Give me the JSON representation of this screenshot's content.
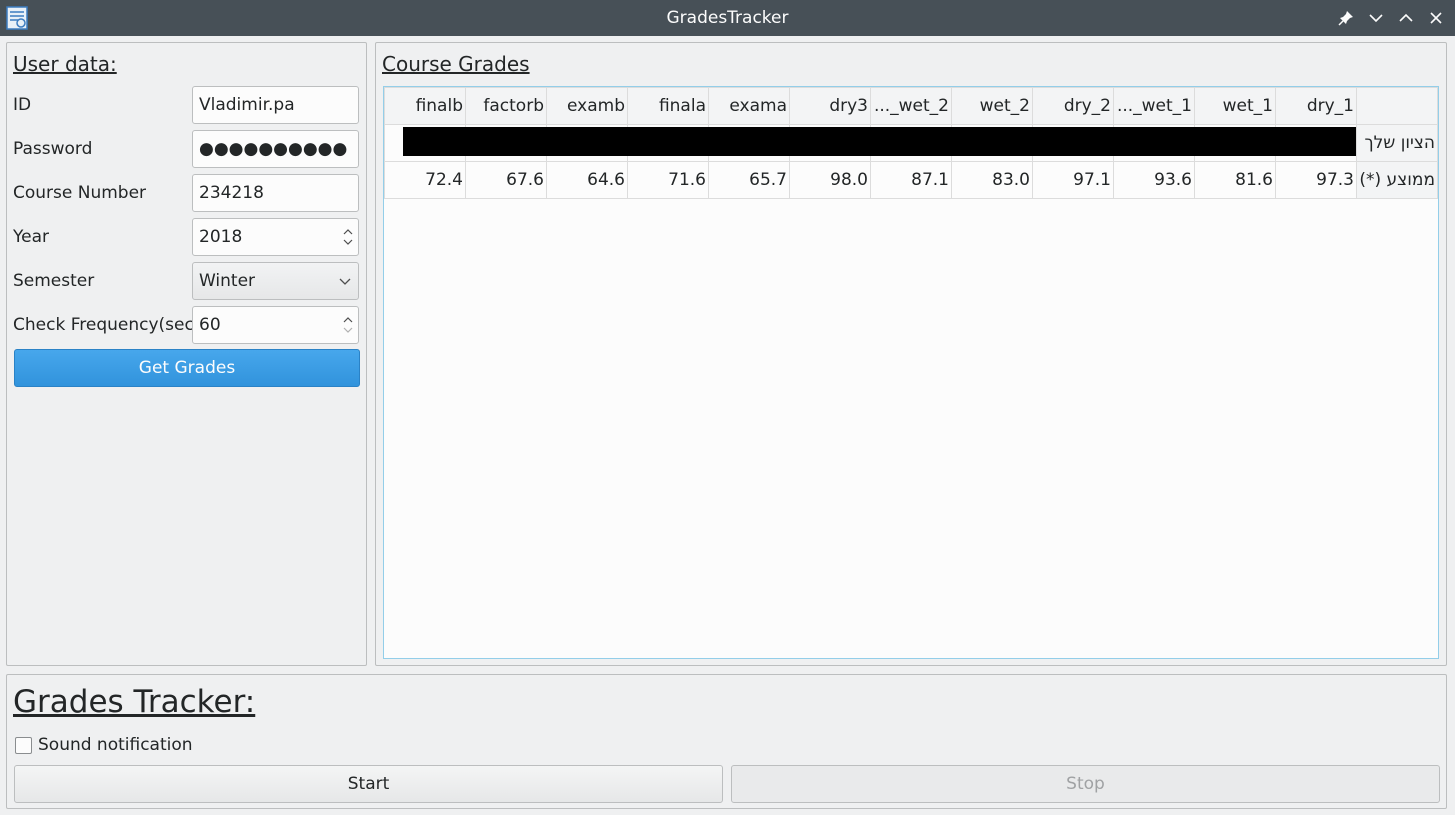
{
  "window": {
    "title": "GradesTracker",
    "buttons": [
      "pin-icon",
      "minimize-icon",
      "maximize-icon",
      "close-icon"
    ]
  },
  "user_data": {
    "title": "User data:",
    "id_label": "ID",
    "id_value": "Vladimir.pa",
    "password_label": "Password",
    "password_value": "●●●●●●●●●●",
    "course_label": "Course Number",
    "course_value": "234218",
    "year_label": "Year",
    "year_value": "2018",
    "semester_label": "Semester",
    "semester_value": "Winter",
    "frequency_label": "Check Frequency(sec)",
    "frequency_value": "60",
    "get_grades_label": "Get Grades"
  },
  "course_grades": {
    "title": "Course Grades",
    "columns": [
      "finalb",
      "factorb",
      "examb",
      "finala",
      "exama",
      "dry3",
      "..._wet_2",
      "wet_2",
      "dry_2",
      "..._wet_1",
      "wet_1",
      "dry_1",
      ""
    ],
    "rows": [
      {
        "label": "הציון שלך",
        "values": [
          "",
          "",
          "",
          "",
          "",
          "",
          "",
          "",
          "",
          "",
          "",
          ""
        ]
      },
      {
        "label": "ממוצע (*)",
        "values": [
          "72.4",
          "67.6",
          "64.6",
          "71.6",
          "65.7",
          "98.0",
          "87.1",
          "83.0",
          "97.1",
          "93.6",
          "81.6",
          "97.3"
        ]
      }
    ]
  },
  "tracker": {
    "title": "Grades Tracker:",
    "sound_label": "Sound notification",
    "sound_checked": false,
    "start_label": "Start",
    "stop_label": "Stop"
  },
  "colors": {
    "titlebar": "#475057",
    "accent": "#3daee9",
    "primary_button": "#3193dc"
  }
}
